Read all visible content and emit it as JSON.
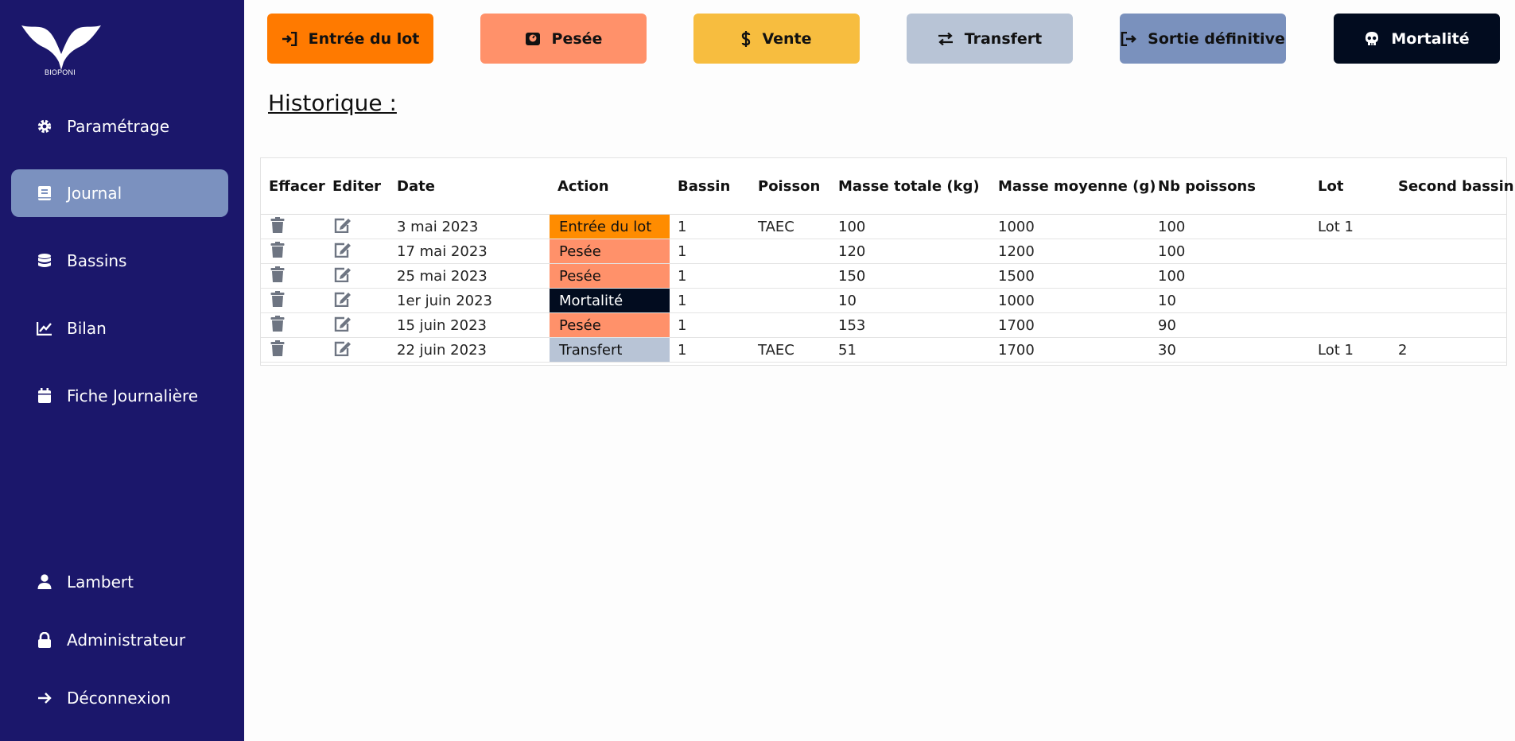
{
  "sidebar": {
    "logo_text": "BIOPONI",
    "nav": [
      {
        "label": "Paramétrage",
        "icon": "gear-icon"
      },
      {
        "label": "Journal",
        "icon": "book-icon",
        "active": true
      },
      {
        "label": "Bassins",
        "icon": "database-icon"
      },
      {
        "label": "Bilan",
        "icon": "chart-line-icon"
      },
      {
        "label": "Fiche Journalière",
        "icon": "calendar-icon"
      }
    ],
    "bottom": [
      {
        "label": "Lambert",
        "icon": "user-icon"
      },
      {
        "label": "Administrateur",
        "icon": "lock-icon"
      },
      {
        "label": "Déconnexion",
        "icon": "arrow-right-icon"
      }
    ]
  },
  "actions": [
    {
      "label": "Entrée du lot",
      "icon": "sign-in-icon",
      "color": "#ff7a00",
      "text_color": "#111111"
    },
    {
      "label": "Pesée",
      "icon": "weight-scale-icon",
      "color": "#ff916a",
      "text_color": "#111111"
    },
    {
      "label": "Vente",
      "icon": "dollar-icon",
      "color": "#f7bd3f",
      "text_color": "#111111"
    },
    {
      "label": "Transfert",
      "icon": "exchange-icon",
      "color": "#b8c4d6",
      "text_color": "#111111"
    },
    {
      "label": "Sortie définitive",
      "icon": "sign-out-icon",
      "color": "#7a91bd",
      "text_color": "#111111"
    },
    {
      "label": "Mortalité",
      "icon": "skull-icon",
      "color": "#020c1f",
      "text_color": "#ffffff"
    }
  ],
  "history": {
    "title": "Historique :",
    "columns": [
      "Effacer",
      "Editer",
      "Date",
      "Action",
      "Bassin",
      "Poisson",
      "Masse totale (kg)",
      "Masse moyenne (g)",
      "Nb poissons",
      "Lot",
      "Second bassin"
    ],
    "rows": [
      {
        "date": "3 mai 2023",
        "action": "Entrée du lot",
        "action_color": "#ff8c00",
        "action_text": "#111111",
        "bassin": "1",
        "poisson": "TAEC",
        "masse_totale": "100",
        "masse_moyenne": "1000",
        "nb_poissons": "100",
        "lot": "Lot 1",
        "second_bassin": ""
      },
      {
        "date": "17 mai 2023",
        "action": "Pesée",
        "action_color": "#ff916a",
        "action_text": "#111111",
        "bassin": "1",
        "poisson": "",
        "masse_totale": "120",
        "masse_moyenne": "1200",
        "nb_poissons": "100",
        "lot": "",
        "second_bassin": ""
      },
      {
        "date": "25 mai 2023",
        "action": "Pesée",
        "action_color": "#ff916a",
        "action_text": "#111111",
        "bassin": "1",
        "poisson": "",
        "masse_totale": "150",
        "masse_moyenne": "1500",
        "nb_poissons": "100",
        "lot": "",
        "second_bassin": ""
      },
      {
        "date": "1er juin 2023",
        "action": "Mortalité",
        "action_color": "#020c1f",
        "action_text": "#ffffff",
        "bassin": "1",
        "poisson": "",
        "masse_totale": "10",
        "masse_moyenne": "1000",
        "nb_poissons": "10",
        "lot": "",
        "second_bassin": ""
      },
      {
        "date": "15 juin 2023",
        "action": "Pesée",
        "action_color": "#ff916a",
        "action_text": "#111111",
        "bassin": "1",
        "poisson": "",
        "masse_totale": "153",
        "masse_moyenne": "1700",
        "nb_poissons": "90",
        "lot": "",
        "second_bassin": ""
      },
      {
        "date": "22 juin 2023",
        "action": "Transfert",
        "action_color": "#b8c4d6",
        "action_text": "#111111",
        "bassin": "1",
        "poisson": "TAEC",
        "masse_totale": "51",
        "masse_moyenne": "1700",
        "nb_poissons": "30",
        "lot": "Lot 1",
        "second_bassin": "2"
      }
    ]
  }
}
